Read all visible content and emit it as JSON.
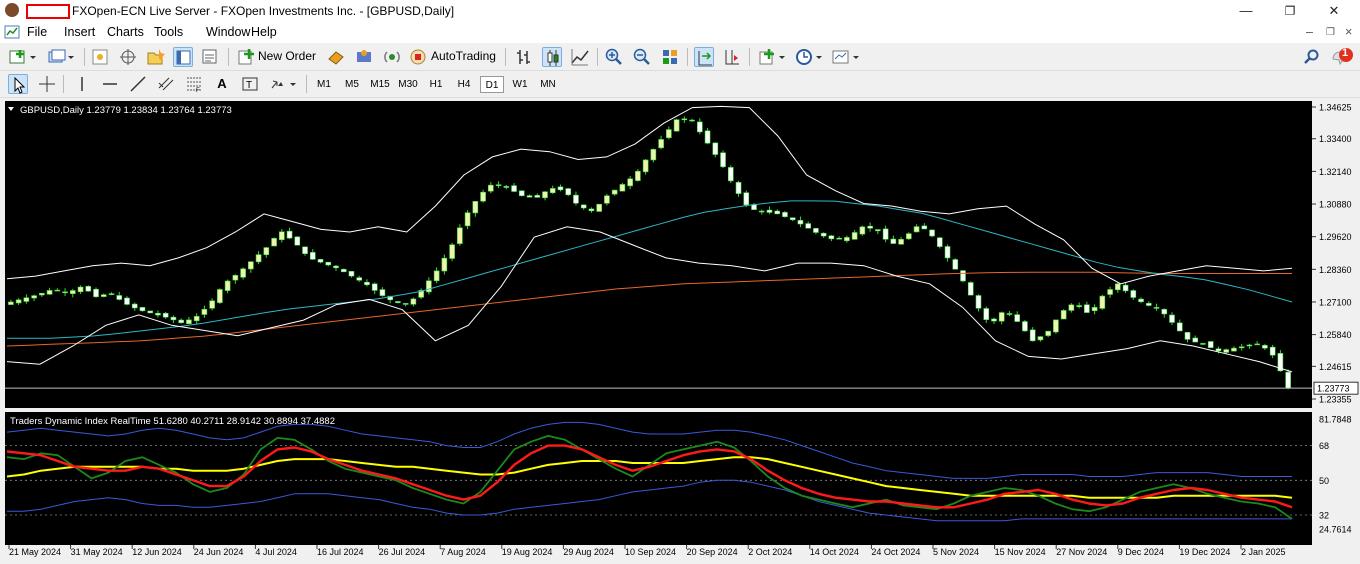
{
  "window": {
    "title": "FXOpen-ECN Live Server - FXOpen Investments Inc. - [GBPUSD,Daily]",
    "minimize_glyph": "—",
    "maximize_glyph": "❐",
    "close_glyph": "✕"
  },
  "menu": {
    "items": [
      "File",
      "Insert",
      "Charts",
      "Tools",
      "Window",
      "Help"
    ]
  },
  "toolbar": {
    "new_order_label": "New Order",
    "autotrading_label": "AutoTrading",
    "notification_count": "1"
  },
  "timeframes": [
    "M1",
    "M5",
    "M15",
    "M30",
    "H1",
    "H4",
    "D1",
    "W1",
    "MN"
  ],
  "active_timeframe": "D1",
  "colors": {
    "chart_bg": "#000000",
    "grid": "#808080",
    "bull_candle": "#f2f2b0",
    "bear_candle": "#ffffff",
    "candle_outline": "#33dd33",
    "bollinger": "#ffffff",
    "ma_mid": "#2fb7c4",
    "ma_long": "#e8662a",
    "tdi_green": "#1a8a1a",
    "tdi_red": "#ff1a1a",
    "tdi_yellow": "#ffff00",
    "tdi_band": "#3a5ad8"
  },
  "chart_data": [
    {
      "type": "candlestick",
      "symbol_header": "GBPUSD,Daily  1.23779 1.23834 1.23764 1.23773",
      "price_ticks": [
        "1.34625",
        "1.33400",
        "1.32140",
        "1.30880",
        "1.29620",
        "1.28360",
        "1.27100",
        "1.25840",
        "1.24615",
        "1.23355"
      ],
      "ylim": [
        1.23355,
        1.34625
      ],
      "current_price_label": "1.23773",
      "current_price": 1.23773,
      "date_ticks": [
        "21 May 2024",
        "31 May 2024",
        "12 Jun 2024",
        "24 Jun 2024",
        "4 Jul 2024",
        "16 Jul 2024",
        "26 Jul 2024",
        "7 Aug 2024",
        "19 Aug 2024",
        "29 Aug 2024",
        "10 Sep 2024",
        "20 Sep 2024",
        "2 Oct 2024",
        "14 Oct 2024",
        "24 Oct 2024",
        "5 Nov 2024",
        "15 Nov 2024",
        "27 Nov 2024",
        "9 Dec 2024",
        "19 Dec 2024",
        "2 Jan 2025"
      ],
      "close_path": [
        1.271,
        1.2725,
        1.274,
        1.276,
        1.2745,
        1.277,
        1.273,
        1.2745,
        1.2705,
        1.268,
        1.2665,
        1.265,
        1.263,
        1.265,
        1.27,
        1.278,
        1.282,
        1.287,
        1.292,
        1.2985,
        1.294,
        1.288,
        1.286,
        1.284,
        1.281,
        1.278,
        1.274,
        1.271,
        1.27,
        1.276,
        1.283,
        1.292,
        1.304,
        1.312,
        1.317,
        1.315,
        1.312,
        1.311,
        1.315,
        1.314,
        1.308,
        1.306,
        1.312,
        1.316,
        1.32,
        1.328,
        1.335,
        1.342,
        1.341,
        1.333,
        1.325,
        1.315,
        1.307,
        1.306,
        1.305,
        1.303,
        1.3,
        1.297,
        1.295,
        1.296,
        1.3,
        1.299,
        1.293,
        1.296,
        1.301,
        1.296,
        1.288,
        1.28,
        1.27,
        1.262,
        1.268,
        1.263,
        1.256,
        1.259,
        1.267,
        1.271,
        1.266,
        1.274,
        1.278,
        1.273,
        1.27,
        1.268,
        1.262,
        1.256,
        1.255,
        1.252,
        1.253,
        1.254,
        1.255,
        1.25,
        1.2377
      ],
      "bollinger_upper": [
        1.28,
        1.281,
        1.283,
        1.285,
        1.286,
        1.285,
        1.288,
        1.292,
        1.298,
        1.305,
        1.302,
        1.299,
        1.298,
        1.3,
        1.298,
        1.308,
        1.32,
        1.327,
        1.33,
        1.329,
        1.326,
        1.327,
        1.332,
        1.34,
        1.346,
        1.3465,
        1.346,
        1.335,
        1.32,
        1.314,
        1.309,
        1.308,
        1.306,
        1.305,
        1.307,
        1.308,
        1.301,
        1.295,
        1.284,
        1.278,
        1.281,
        1.283,
        1.285,
        1.284,
        1.283,
        1.284
      ],
      "bollinger_lower": [
        1.248,
        1.247,
        1.254,
        1.262,
        1.266,
        1.262,
        1.26,
        1.258,
        1.261,
        1.264,
        1.27,
        1.272,
        1.268,
        1.256,
        1.262,
        1.277,
        1.296,
        1.3,
        1.298,
        1.293,
        1.288,
        1.286,
        1.285,
        1.283,
        1.286,
        1.286,
        1.285,
        1.281,
        1.278,
        1.269,
        1.256,
        1.25,
        1.249,
        1.251,
        1.253,
        1.256,
        1.254,
        1.251,
        1.248,
        1.244
      ],
      "ma_mid_path": [
        1.257,
        1.257,
        1.258,
        1.26,
        1.262,
        1.265,
        1.268,
        1.27,
        1.272,
        1.275,
        1.28,
        1.285,
        1.29,
        1.295,
        1.3,
        1.305,
        1.308,
        1.31,
        1.31,
        1.308,
        1.305,
        1.3,
        1.295,
        1.29,
        1.285,
        1.282,
        1.28,
        1.276,
        1.271
      ],
      "ma_long_path": [
        1.254,
        1.255,
        1.256,
        1.258,
        1.261,
        1.264,
        1.267,
        1.27,
        1.273,
        1.276,
        1.278,
        1.279,
        1.28,
        1.281,
        1.282,
        1.2825,
        1.2825,
        1.282,
        1.282,
        1.282
      ]
    },
    {
      "type": "line",
      "indicator_header": "Traders Dynamic Index RealTime 51.6280 40.2711 28.9142 30.8894 37.4882",
      "ylim": [
        24.7614,
        81.7848
      ],
      "tick_labels": [
        "81.7848",
        "68",
        "50",
        "32",
        "24.7614"
      ],
      "levels": [
        68,
        50,
        32
      ],
      "series": [
        {
          "values": [
            62,
            61,
            64,
            63,
            57,
            51,
            54,
            60,
            62,
            58,
            54,
            48,
            44,
            46,
            53,
            66,
            72,
            71,
            66,
            60,
            56,
            54,
            52,
            50,
            46,
            43,
            40,
            38,
            44,
            55,
            66,
            70,
            73,
            71,
            66,
            61,
            56,
            52,
            58,
            64,
            66,
            68,
            70,
            67,
            60,
            52,
            46,
            42,
            40,
            38,
            36,
            38,
            40,
            37,
            36,
            35,
            38,
            42,
            44,
            46,
            45,
            42,
            38,
            35,
            34,
            36,
            40,
            44,
            46,
            48,
            46,
            43,
            41,
            39,
            38,
            36,
            30
          ]
        },
        {
          "values": [
            65,
            64,
            63,
            60,
            57,
            56,
            55,
            55,
            57,
            56,
            53,
            50,
            47,
            47,
            52,
            60,
            66,
            67,
            65,
            61,
            58,
            55,
            53,
            51,
            48,
            45,
            42,
            40,
            42,
            49,
            58,
            64,
            68,
            68,
            66,
            62,
            58,
            55,
            57,
            60,
            63,
            65,
            66,
            65,
            61,
            55,
            50,
            46,
            43,
            41,
            40,
            39,
            39,
            38,
            37,
            36,
            36,
            38,
            40,
            43,
            44,
            45,
            43,
            40,
            38,
            37,
            38,
            41,
            43,
            45,
            46,
            45,
            43,
            41,
            40,
            39,
            36
          ]
        },
        {
          "values": [
            52,
            53,
            55,
            56,
            57,
            57,
            57,
            57,
            57,
            56,
            56,
            55,
            55,
            55,
            56,
            58,
            60,
            61,
            61,
            61,
            60,
            59,
            58,
            57,
            57,
            56,
            55,
            54,
            53,
            53,
            54,
            56,
            58,
            59,
            60,
            60,
            60,
            59,
            59,
            59,
            59,
            60,
            61,
            62,
            62,
            61,
            59,
            57,
            55,
            53,
            51,
            49,
            47,
            46,
            45,
            44,
            43,
            42,
            42,
            42,
            42,
            42,
            42,
            42,
            41,
            41,
            41,
            41,
            41,
            42,
            42,
            42,
            42,
            42,
            42,
            42,
            41
          ]
        },
        {
          "values": [
            75,
            76,
            77,
            76,
            75,
            74,
            73,
            74,
            76,
            77,
            76,
            74,
            72,
            71,
            72,
            75,
            78,
            79,
            79,
            78,
            76,
            74,
            73,
            72,
            71,
            70,
            68,
            67,
            67,
            70,
            74,
            77,
            79,
            80,
            80,
            79,
            77,
            75,
            74,
            74,
            74,
            75,
            76,
            76,
            75,
            73,
            71,
            68,
            65,
            62,
            59,
            57,
            55,
            54,
            53,
            52,
            51,
            51,
            51,
            52,
            53,
            53,
            53,
            53,
            52,
            52,
            52,
            53,
            54,
            54,
            54,
            54,
            53,
            52,
            52,
            52,
            52
          ]
        },
        {
          "values": [
            34,
            34,
            35,
            37,
            39,
            40,
            41,
            40,
            38,
            37,
            37,
            36,
            36,
            37,
            38,
            39,
            41,
            43,
            43,
            43,
            42,
            41,
            40,
            38,
            36,
            35,
            33,
            32,
            32,
            33,
            35,
            36,
            37,
            38,
            39,
            40,
            42,
            44,
            45,
            46,
            47,
            49,
            50,
            50,
            49,
            47,
            45,
            42,
            39,
            37,
            35,
            33,
            32,
            31,
            30,
            29,
            29,
            29,
            29,
            29,
            30,
            30,
            30,
            30,
            30,
            30,
            30,
            30,
            30,
            30,
            30,
            30,
            30,
            30,
            30,
            30,
            30
          ]
        }
      ]
    }
  ]
}
